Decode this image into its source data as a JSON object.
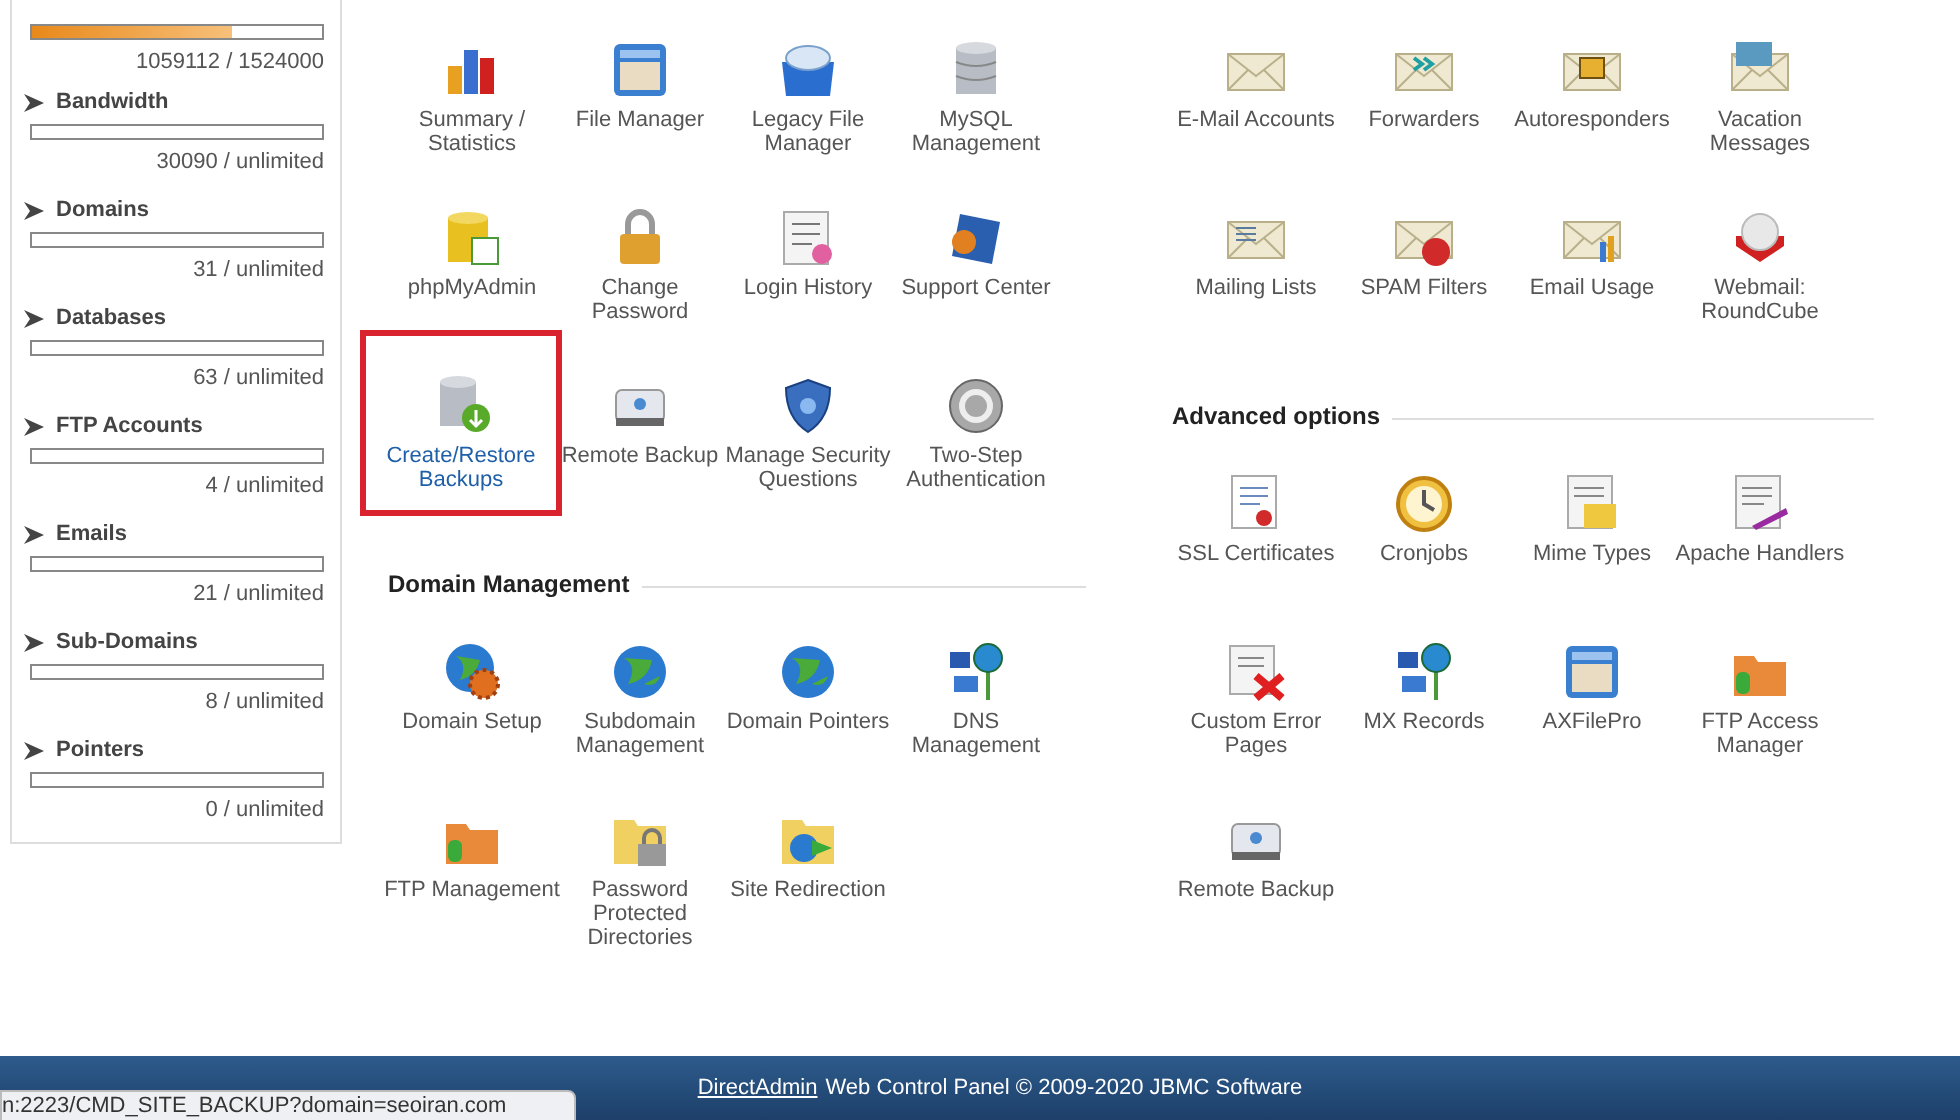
{
  "sidebar": {
    "stats": [
      {
        "level": 0.69,
        "reading": "1059112 / 1524000"
      },
      {
        "name": "Bandwidth",
        "level": 0,
        "reading": "30090 / unlimited"
      },
      {
        "name": "Domains",
        "level": 0,
        "reading": "31 / unlimited"
      },
      {
        "name": "Databases",
        "level": 0,
        "reading": "63 / unlimited"
      },
      {
        "name": "FTP Accounts",
        "level": 0,
        "reading": "4 / unlimited"
      },
      {
        "name": "Emails",
        "level": 0,
        "reading": "21 / unlimited"
      },
      {
        "name": "Sub-Domains",
        "level": 0,
        "reading": "8 / unlimited"
      },
      {
        "name": "Pointers",
        "level": 0,
        "reading": "0 / unlimited"
      }
    ]
  },
  "columns": [
    {
      "sections": [
        {
          "items": [
            {
              "label": "Summary / Statistics",
              "kind": "chart",
              "highlighted": false
            },
            {
              "label": "File Manager",
              "kind": "drawer",
              "highlighted": false
            },
            {
              "label": "Legacy File Manager",
              "kind": "box",
              "highlighted": false
            },
            {
              "label": "MySQL Management",
              "kind": "database",
              "highlighted": false
            },
            {
              "label": "phpMyAdmin",
              "kind": "database-doc",
              "highlighted": false
            },
            {
              "label": "Change Password",
              "kind": "lock",
              "highlighted": false
            },
            {
              "label": "Login History",
              "kind": "list",
              "highlighted": false
            },
            {
              "label": "Support Center",
              "kind": "book",
              "highlighted": false
            },
            {
              "label": "Create/Restore Backups",
              "kind": "database-down",
              "highlighted": true
            },
            {
              "label": "Remote Backup",
              "kind": "drive",
              "highlighted": false
            },
            {
              "label": "Manage Security Questions",
              "kind": "shield",
              "highlighted": false
            },
            {
              "label": "Two-Step Authentication",
              "kind": "dial",
              "highlighted": false
            }
          ]
        },
        {
          "title": "Domain Management",
          "items": [
            {
              "label": "Domain Setup",
              "kind": "globe-gear",
              "highlighted": false
            },
            {
              "label": "Subdomain Management",
              "kind": "globe",
              "highlighted": false
            },
            {
              "label": "Domain Pointers",
              "kind": "globe",
              "highlighted": false
            },
            {
              "label": "DNS Management",
              "kind": "network",
              "highlighted": false
            },
            {
              "label": "FTP Management",
              "kind": "folder",
              "highlighted": false
            },
            {
              "label": "Password Protected Directories",
              "kind": "folder-lock",
              "highlighted": false
            },
            {
              "label": "Site Redirection",
              "kind": "folder-globe",
              "highlighted": false
            }
          ]
        }
      ]
    },
    {
      "sections": [
        {
          "items": [
            {
              "label": "E-Mail Accounts",
              "kind": "envelope",
              "highlighted": false
            },
            {
              "label": "Forwarders",
              "kind": "envelope-arrows",
              "highlighted": false
            },
            {
              "label": "Autoresponders",
              "kind": "envelope-letter",
              "highlighted": false
            },
            {
              "label": "Vacation Messages",
              "kind": "envelope-photo",
              "highlighted": false
            },
            {
              "label": "Mailing Lists",
              "kind": "envelope-list",
              "highlighted": false
            },
            {
              "label": "SPAM Filters",
              "kind": "envelope-stop",
              "highlighted": false
            },
            {
              "label": "Email Usage",
              "kind": "envelope-bars",
              "highlighted": false
            },
            {
              "label": "Webmail: RoundCube",
              "kind": "dome",
              "highlighted": false
            }
          ]
        },
        {
          "title": "Advanced options",
          "items": [
            {
              "label": "SSL Certificates",
              "kind": "certificate",
              "highlighted": false
            },
            {
              "label": "Cronjobs",
              "kind": "clock",
              "highlighted": false
            },
            {
              "label": "Mime Types",
              "kind": "document",
              "highlighted": false
            },
            {
              "label": "Apache Handlers",
              "kind": "document-pen",
              "highlighted": false
            },
            {
              "label": "Custom Error Pages",
              "kind": "page-error",
              "highlighted": false
            },
            {
              "label": "MX Records",
              "kind": "network",
              "highlighted": false
            },
            {
              "label": "AXFilePro",
              "kind": "drawer",
              "highlighted": false
            },
            {
              "label": "FTP Access Manager",
              "kind": "folder",
              "highlighted": false
            },
            {
              "label": "Remote Backup",
              "kind": "drive",
              "highlighted": false
            }
          ]
        }
      ]
    }
  ],
  "footer": {
    "link": "DirectAdmin",
    "text": "Web Control Panel © 2009-2020 JBMC Software"
  },
  "status_url": "n:2223/CMD_SITE_BACKUP?domain=seoiran.com"
}
